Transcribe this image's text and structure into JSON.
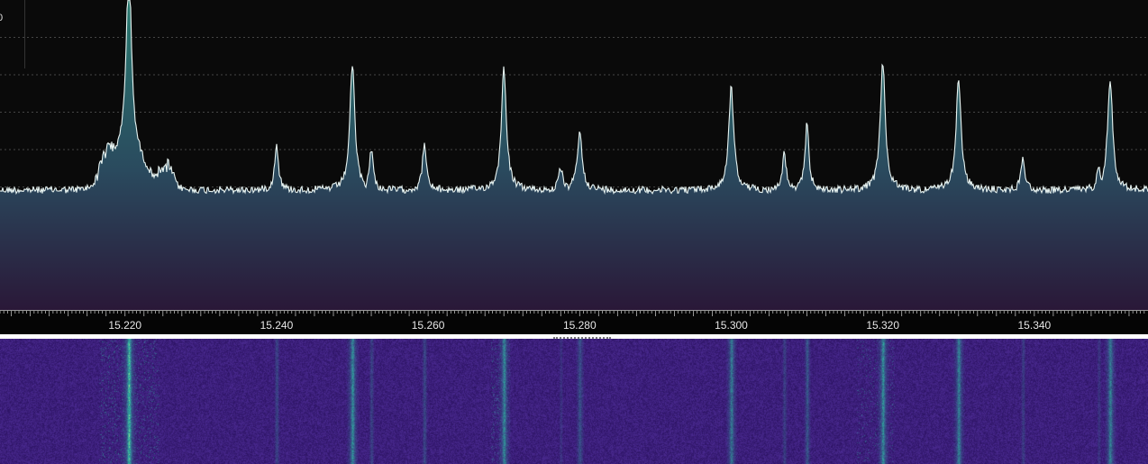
{
  "spectrum": {
    "scale_label": "0",
    "colors": {
      "background": "#0a0a0a",
      "trace": "#e8f4f2",
      "fill_top": "#2a7a70",
      "fill_mid": "#2a4a5e",
      "fill_bottom": "#2a1838",
      "grid": "#5a5a5a"
    }
  },
  "frequency_axis": {
    "unit_implied": "MHz",
    "range": [
      15.2035,
      15.355
    ],
    "labels": [
      {
        "value": 15.22,
        "text": "15.220"
      },
      {
        "value": 15.24,
        "text": "15.240"
      },
      {
        "value": 15.26,
        "text": "15.260"
      },
      {
        "value": 15.28,
        "text": "15.280"
      },
      {
        "value": 15.3,
        "text": "15.300"
      },
      {
        "value": 15.32,
        "text": "15.320"
      },
      {
        "value": 15.34,
        "text": "15.340"
      }
    ]
  },
  "signals": [
    {
      "freq": 15.2205,
      "level": 1.0,
      "width": 0.0004
    },
    {
      "freq": 15.25,
      "level": 0.66,
      "width": 0.0004
    },
    {
      "freq": 15.2525,
      "level": 0.22,
      "width": 0.0003
    },
    {
      "freq": 15.24,
      "level": 0.24,
      "width": 0.0003
    },
    {
      "freq": 15.2595,
      "level": 0.25,
      "width": 0.0003
    },
    {
      "freq": 15.27,
      "level": 0.64,
      "width": 0.0004
    },
    {
      "freq": 15.28,
      "level": 0.3,
      "width": 0.0004
    },
    {
      "freq": 15.2775,
      "level": 0.12,
      "width": 0.0003
    },
    {
      "freq": 15.3,
      "level": 0.54,
      "width": 0.0004
    },
    {
      "freq": 15.307,
      "level": 0.2,
      "width": 0.0003
    },
    {
      "freq": 15.31,
      "level": 0.36,
      "width": 0.0003
    },
    {
      "freq": 15.32,
      "level": 0.67,
      "width": 0.0004
    },
    {
      "freq": 15.33,
      "level": 0.58,
      "width": 0.0004
    },
    {
      "freq": 15.3385,
      "level": 0.18,
      "width": 0.0003
    },
    {
      "freq": 15.35,
      "level": 0.59,
      "width": 0.0004
    },
    {
      "freq": 15.3485,
      "level": 0.14,
      "width": 0.0003
    }
  ],
  "waterfall": {
    "colors": {
      "background": "#3a1a78",
      "noise_a": "#4a2a90",
      "noise_b": "#2e1466",
      "signal": "#2fb0a0",
      "strong": "#b8e890"
    }
  }
}
